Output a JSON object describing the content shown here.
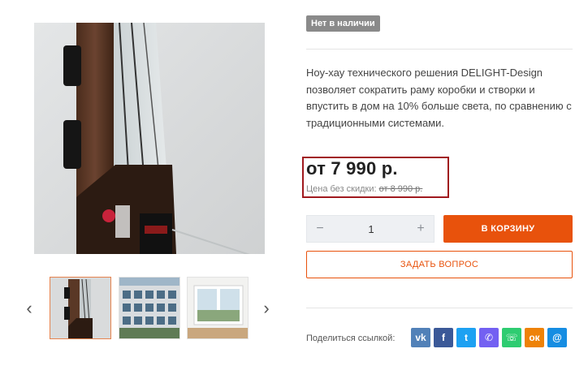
{
  "product": {
    "stock_badge": "Нет в наличии",
    "description": "Ноу-хау технического решения DELIGHT-Design позволяет сократить раму коробки и створки и впустить в дом на 10% больше света, по сравнению с традиционными системами.",
    "price": "от 7 990 р.",
    "old_price_label": "Цена без скидки:",
    "old_price": "от 8 990 р."
  },
  "quantity": {
    "minus": "−",
    "value": "1",
    "plus": "+"
  },
  "buttons": {
    "add_to_cart": "В КОРЗИНУ",
    "ask_question": "ЗАДАТЬ ВОПРОС"
  },
  "gallery": {
    "prev": "‹",
    "next": "›"
  },
  "share": {
    "label": "Поделиться ссылкой:",
    "icons": [
      {
        "name": "vk-icon",
        "glyph": "vk",
        "color": "#5181b8"
      },
      {
        "name": "facebook-icon",
        "glyph": "f",
        "color": "#3b5998"
      },
      {
        "name": "twitter-icon",
        "glyph": "t",
        "color": "#1da1f2"
      },
      {
        "name": "viber-icon",
        "glyph": "✆",
        "color": "#7360f2"
      },
      {
        "name": "whatsapp-icon",
        "glyph": "☏",
        "color": "#2ecc71"
      },
      {
        "name": "odnoklassniki-icon",
        "glyph": "ок",
        "color": "#ee8208"
      },
      {
        "name": "moimir-icon",
        "glyph": "@",
        "color": "#168de2"
      }
    ]
  },
  "colors": {
    "accent": "#e8520c",
    "price_highlight": "#a0191e",
    "badge": "#8a8a8a"
  }
}
